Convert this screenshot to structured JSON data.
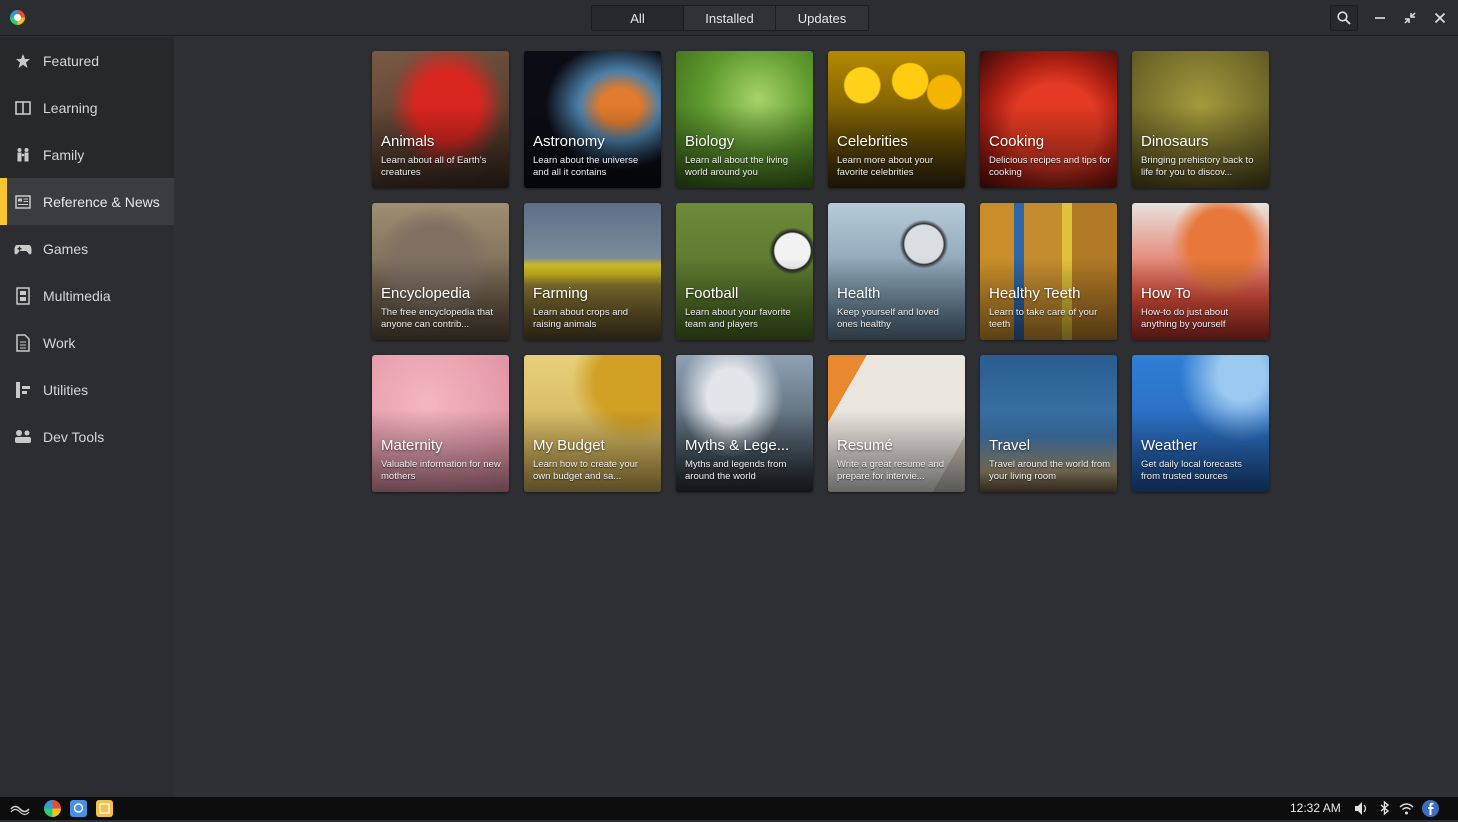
{
  "tabs": [
    "All",
    "Installed",
    "Updates"
  ],
  "sidebar": {
    "items": [
      {
        "label": "Featured",
        "icon": "star-icon"
      },
      {
        "label": "Learning",
        "icon": "book-icon"
      },
      {
        "label": "Family",
        "icon": "family-icon"
      },
      {
        "label": "Reference & News",
        "icon": "newspaper-icon"
      },
      {
        "label": "Games",
        "icon": "gamepad-icon"
      },
      {
        "label": "Multimedia",
        "icon": "film-icon"
      },
      {
        "label": "Work",
        "icon": "document-icon"
      },
      {
        "label": "Utilities",
        "icon": "tools-icon"
      },
      {
        "label": "Dev Tools",
        "icon": "devtools-icon"
      }
    ],
    "selected": "Reference & News"
  },
  "tiles": [
    {
      "title": "Animals",
      "desc": "Learn about all of Earth's creatures"
    },
    {
      "title": "Astronomy",
      "desc": "Learn about the universe and all it contains"
    },
    {
      "title": "Biology",
      "desc": "Learn all about the living world around you"
    },
    {
      "title": "Celebrities",
      "desc": "Learn more about your favorite celebrities"
    },
    {
      "title": "Cooking",
      "desc": "Delicious recipes and tips for cooking"
    },
    {
      "title": "Dinosaurs",
      "desc": "Bringing prehistory back to life for you to discov..."
    },
    {
      "title": "Encyclopedia",
      "desc": "The free encyclopedia that anyone can contrib..."
    },
    {
      "title": "Farming",
      "desc": "Learn about crops and raising animals"
    },
    {
      "title": "Football",
      "desc": "Learn about your favorite team and players"
    },
    {
      "title": "Health",
      "desc": "Keep yourself and loved ones healthy"
    },
    {
      "title": "Healthy Teeth",
      "desc": "Learn to take care of your teeth"
    },
    {
      "title": "How To",
      "desc": "How-to do just about anything by yourself"
    },
    {
      "title": "Maternity",
      "desc": "Valuable information for new mothers"
    },
    {
      "title": "My Budget",
      "desc": "Learn how to create your own budget and sa..."
    },
    {
      "title": "Myths & Lege...",
      "desc": "Myths and legends from around the world"
    },
    {
      "title": "Resumé",
      "desc": "Write a great resume and prepare for intervie..."
    },
    {
      "title": "Travel",
      "desc": "Travel around the world from your living room"
    },
    {
      "title": "Weather",
      "desc": "Get daily local forecasts from trusted sources"
    }
  ],
  "taskbar": {
    "clock": "12:32 AM",
    "icons": [
      "menu-icon",
      "app-center-icon",
      "chat-icon",
      "files-icon",
      "volume-icon",
      "bluetooth-icon",
      "wifi-icon",
      "facebook-icon"
    ]
  },
  "colors": {
    "accent": "#f7c531",
    "background": "#2e3033",
    "sidebar": "#2b2d30"
  }
}
